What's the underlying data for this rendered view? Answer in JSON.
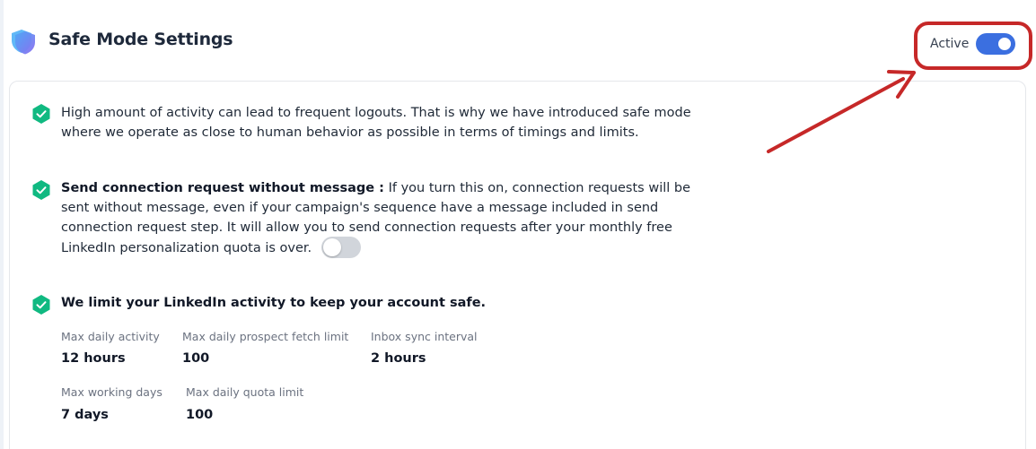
{
  "header": {
    "title": "Safe Mode Settings",
    "icon": "shield-icon"
  },
  "active_toggle": {
    "label": "Active",
    "state": "on"
  },
  "intro": {
    "text": "High amount of activity can lead to frequent logouts. That is why we have introduced safe mode where we operate as close to human behavior as possible in terms of timings and limits."
  },
  "connection_request": {
    "title": "Send connection request without message :",
    "description": "If you turn this on, connection requests will be sent without message, even if your campaign's sequence have a message included in send connection request step. It will allow you to send connection requests after your monthly free LinkedIn personalization quota is over.",
    "toggle_state": "off"
  },
  "limits": {
    "title": "We limit your LinkedIn activity to keep your account safe.",
    "max_daily_activity": {
      "label": "Max daily activity",
      "value": "12 hours"
    },
    "max_daily_prospect_fetch_limit": {
      "label": "Max daily prospect fetch limit",
      "value": "100"
    },
    "inbox_sync_interval": {
      "label": "Inbox sync interval",
      "value": "2 hours"
    },
    "max_working_days": {
      "label": "Max working days",
      "value": "7 days"
    },
    "max_daily_quota_limit": {
      "label": "Max daily quota limit",
      "value": "100"
    }
  },
  "colors": {
    "accent_blue": "#3b6fe0",
    "check_green": "#10b981",
    "annotation_red": "#c62828"
  }
}
